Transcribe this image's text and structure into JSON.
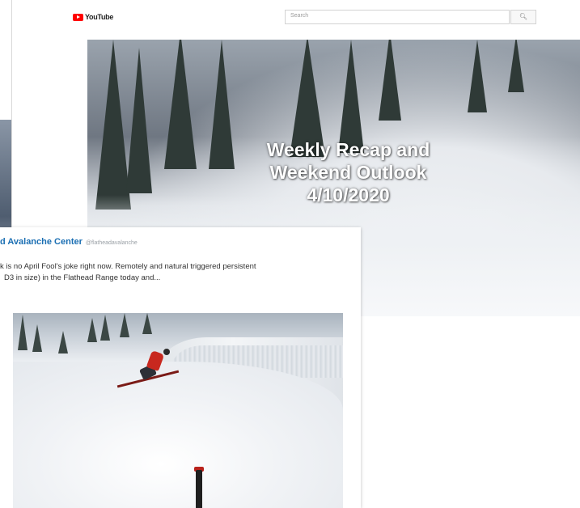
{
  "youtube": {
    "logo_text": "YouTube",
    "search": {
      "placeholder": "Search"
    },
    "video": {
      "title_lines": [
        "Weekly Recap and",
        "Weekend Outlook",
        "4/10/2020"
      ]
    }
  },
  "tweet": {
    "name": "d Avalanche Center",
    "handle": "@flatheadavalanche",
    "text_lines": [
      "k is no April Fool's joke right now. Remotely and natural triggered persistent",
      "D3 in size) in the Flathead Range today and..."
    ]
  },
  "colors": {
    "youtube_red": "#ff0000",
    "link_blue": "#1b6fb3"
  },
  "icons": {
    "youtube_logo": "youtube-logo-icon",
    "search": "search-icon"
  }
}
